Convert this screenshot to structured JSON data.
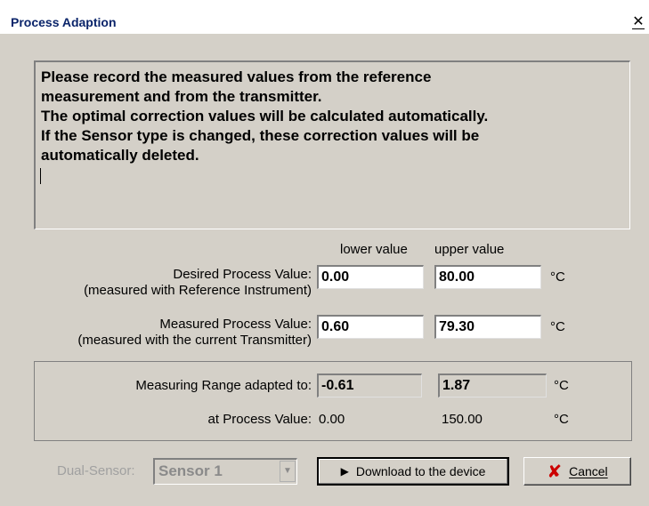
{
  "window": {
    "title": "Process Adaption",
    "close_glyph": "✕"
  },
  "info": {
    "text": "Please record the measured values from the reference\nmeasurement and from the transmitter.\nThe optimal correction values will be calculated automatically.\nIf the Sensor type is changed, these correction values will be\nautomatically deleted."
  },
  "columns": {
    "lower": "lower value",
    "upper": "upper value"
  },
  "desired": {
    "label": "Desired Process Value:",
    "sublabel": "(measured with Reference Instrument)",
    "lower": "0.00",
    "upper": "80.00",
    "unit": "°C"
  },
  "measured": {
    "label": "Measured Process Value:",
    "sublabel": "(measured with the current Transmitter)",
    "lower": "0.60",
    "upper": "79.30",
    "unit": "°C"
  },
  "range": {
    "label": "Measuring Range adapted to:",
    "lower": "-0.61",
    "upper": "1.87",
    "unit": "°C"
  },
  "at_process": {
    "label": "at Process Value:",
    "lower": "0.00",
    "upper": "150.00",
    "unit": "°C"
  },
  "dual_sensor": {
    "label": "Dual-Sensor:",
    "value": "Sensor 1"
  },
  "buttons": {
    "download": "Download to the device",
    "cancel": "Cancel"
  },
  "icons": {
    "download": "play-arrow-icon",
    "cancel": "red-x-icon",
    "cancel_color": "#cc0000"
  }
}
